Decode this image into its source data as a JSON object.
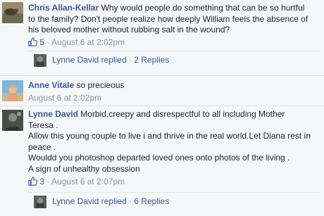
{
  "comments": [
    {
      "author": "Chris Allan-Kellar",
      "text_line1": " Why would people do something that can be so hurtful",
      "text_line2": "to the family? Don't people realize how deeply William feels the absence of",
      "text_line3": "his beloved mother without rubbing salt in the wound?",
      "likes": "5",
      "sep": " · ",
      "time": "August 6 at 2:02pm",
      "replies": {
        "author": "Lynne David replied",
        "dot": " · ",
        "count_label": "2 Replies"
      }
    },
    {
      "author": "Anne Vitale",
      "text": " so precieous",
      "time": "August 6 at 2:02pm"
    },
    {
      "author": "Lynne David",
      "text_line1": " Morbid,creepy and disrespectful to all including Mother",
      "text_line2": "Teresa .",
      "text_line3": "Allow this young couple to live i and thrive in the real world.Let Diana rest in",
      "text_line4": "peace .",
      "text_line5": "Wouldd you photoshop departed loved ones onto photos of the living .",
      "text_line6": "A sign of unhealthy obsession",
      "likes": "3",
      "sep": " · ",
      "time": "August 6 at 2:07pm",
      "replies": {
        "author": "Lynne David replied",
        "dot": " · ",
        "count_label": "6 Replies"
      }
    }
  ],
  "colors": {
    "link": "#365899",
    "meta": "#90949c",
    "background": "#f6f7f9"
  },
  "icons": {
    "like": "thumbs-up-icon"
  }
}
